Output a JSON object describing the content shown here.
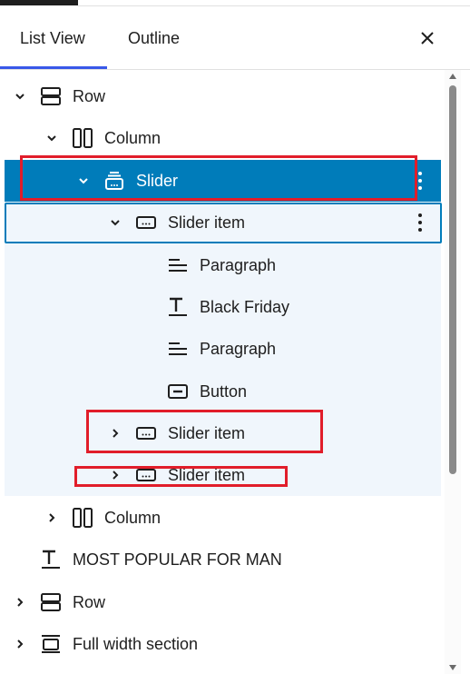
{
  "tabs": {
    "list_view": "List View",
    "outline": "Outline",
    "close_icon": "close-icon"
  },
  "colors": {
    "selected_row": "#007cba",
    "selected_children_bg": "#f0f6fc",
    "active_tab_underline": "#3858e9",
    "highlight_box": "#e11d2a"
  },
  "tree": {
    "row": "Row",
    "column": "Column",
    "slider": "Slider",
    "slider_item_1": "Slider item",
    "paragraph_1": "Paragraph",
    "heading_black_friday": "Black Friday",
    "paragraph_2": "Paragraph",
    "button": "Button",
    "slider_item_2": "Slider item",
    "slider_item_3": "Slider item",
    "column_2": "Column",
    "heading_most_popular": "MOST POPULAR FOR MAN",
    "row_2": "Row",
    "full_width_section": "Full width section"
  }
}
